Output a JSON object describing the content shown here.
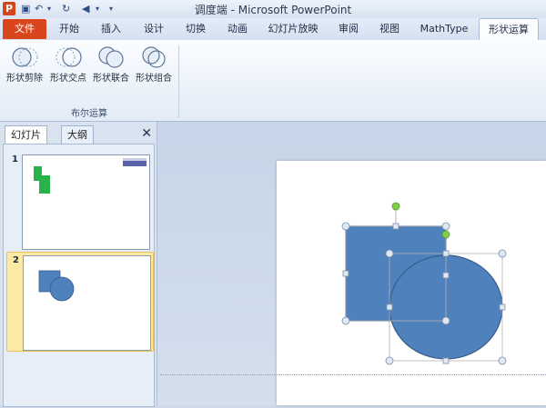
{
  "titlebar": {
    "app_letter": "P",
    "title": "调度端 - Microsoft PowerPoint",
    "quick_access": [
      "save-icon",
      "undo-icon",
      "redo-icon",
      "play-icon",
      "dropdown-icon"
    ]
  },
  "tabs": [
    "文件",
    "开始",
    "插入",
    "设计",
    "切换",
    "动画",
    "幻灯片放映",
    "审阅",
    "视图",
    "MathType",
    "形状运算"
  ],
  "ribbon": {
    "group_label": "布尔运算",
    "buttons": [
      {
        "label": "形状剪除",
        "icon": "shape-subtract-icon"
      },
      {
        "label": "形状交点",
        "icon": "shape-intersect-icon"
      },
      {
        "label": "形状联合",
        "icon": "shape-union-icon"
      },
      {
        "label": "形状组合",
        "icon": "shape-combine-icon"
      }
    ]
  },
  "pane": {
    "tab_slides": "幻灯片",
    "tab_outline": "大纲",
    "close": "✕",
    "slide_numbers": [
      "1",
      "2"
    ],
    "selected_slide": "2"
  },
  "colors": {
    "shape_fill": "#4f81bd",
    "shape_stroke": "#385d8a",
    "handle_fill": "#dfe8f5",
    "rotate_handle": "#7fcf4a",
    "thumb1_shape": "#28b34a"
  }
}
